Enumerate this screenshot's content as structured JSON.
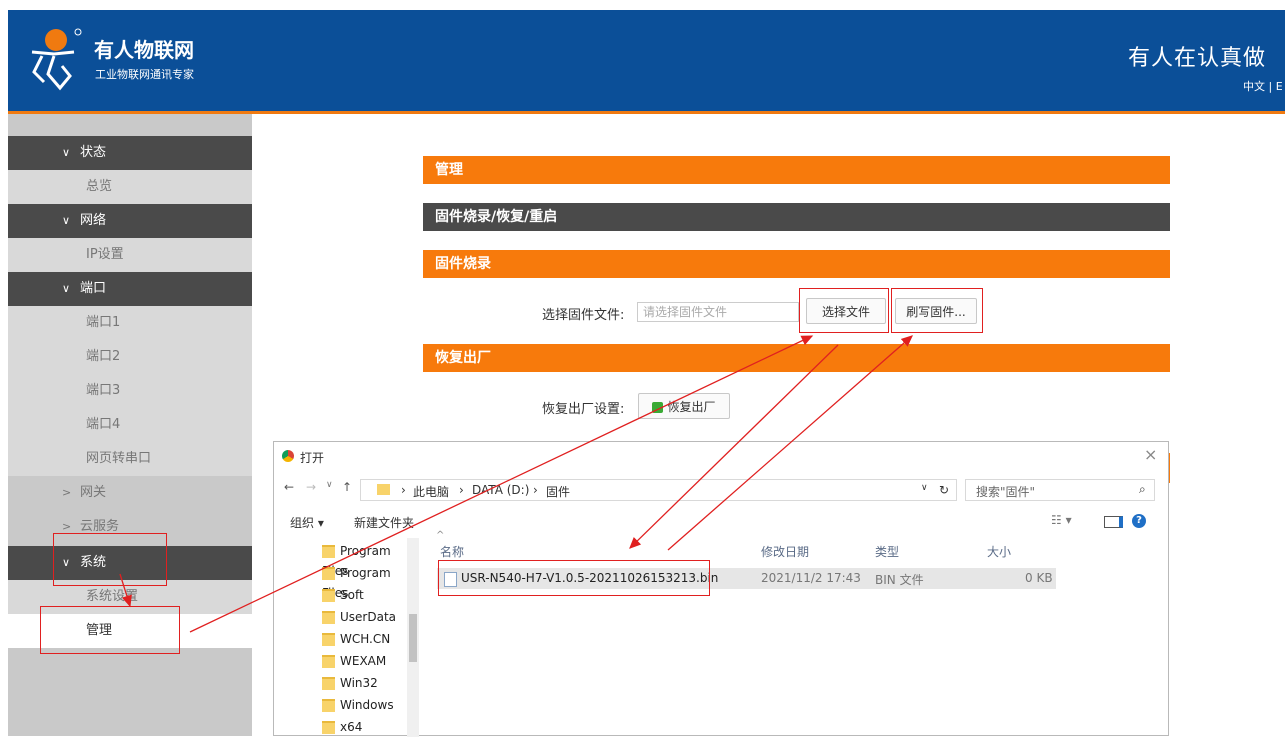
{
  "header": {
    "brand": "有人物联网",
    "tagline": "工业物联网通讯专家",
    "slogan": "有人在认真做",
    "lang": "中文 | E"
  },
  "sidebar": {
    "items": [
      {
        "label": "状态",
        "type": "head"
      },
      {
        "label": "总览",
        "type": "sub"
      },
      {
        "label": "网络",
        "type": "head"
      },
      {
        "label": "IP设置",
        "type": "sub"
      },
      {
        "label": "端口",
        "type": "head"
      },
      {
        "label": "端口1",
        "type": "sub"
      },
      {
        "label": "端口2",
        "type": "sub"
      },
      {
        "label": "端口3",
        "type": "sub"
      },
      {
        "label": "端口4",
        "type": "sub"
      },
      {
        "label": "网页转串口",
        "type": "sub"
      },
      {
        "label": "网关",
        "type": "collapsed"
      },
      {
        "label": "云服务",
        "type": "collapsed"
      },
      {
        "label": "系统",
        "type": "head"
      },
      {
        "label": "系统设置",
        "type": "sub"
      },
      {
        "label": "管理",
        "type": "active"
      }
    ]
  },
  "main": {
    "bar_manage": "管理",
    "bar_firmware_section": "固件烧录/恢复/重启",
    "bar_firmware_burn": "固件烧录",
    "select_label": "选择固件文件:",
    "file_placeholder": "请选择固件文件",
    "choose_file_button": "选择文件",
    "flash_button": "刷写固件...",
    "bar_restore": "恢复出厂",
    "restore_label": "恢复出厂设置:",
    "restore_button": "恢复出厂"
  },
  "dialog": {
    "title": "打开",
    "close": "×",
    "path": [
      "此电脑",
      "DATA (D:)",
      "固件"
    ],
    "search_placeholder": "搜索\"固件\"",
    "organize": "组织 ▾",
    "new_folder": "新建文件夹",
    "folders": [
      "Program Files",
      "Program Files",
      "Soft",
      "UserData",
      "WCH.CN",
      "WEXAM",
      "Win32",
      "Windows",
      "x64"
    ],
    "columns": [
      "名称",
      "修改日期",
      "类型",
      "大小"
    ],
    "files": [
      {
        "name": "USR-N540-H7-V1.0.5-20211026153213.bin",
        "date": "2021/11/2 17:43",
        "type": "BIN 文件",
        "size": "0 KB"
      }
    ]
  },
  "colors": {
    "header": "#0b4f98",
    "accent": "#f77a0c",
    "annotation": "#e02020"
  }
}
